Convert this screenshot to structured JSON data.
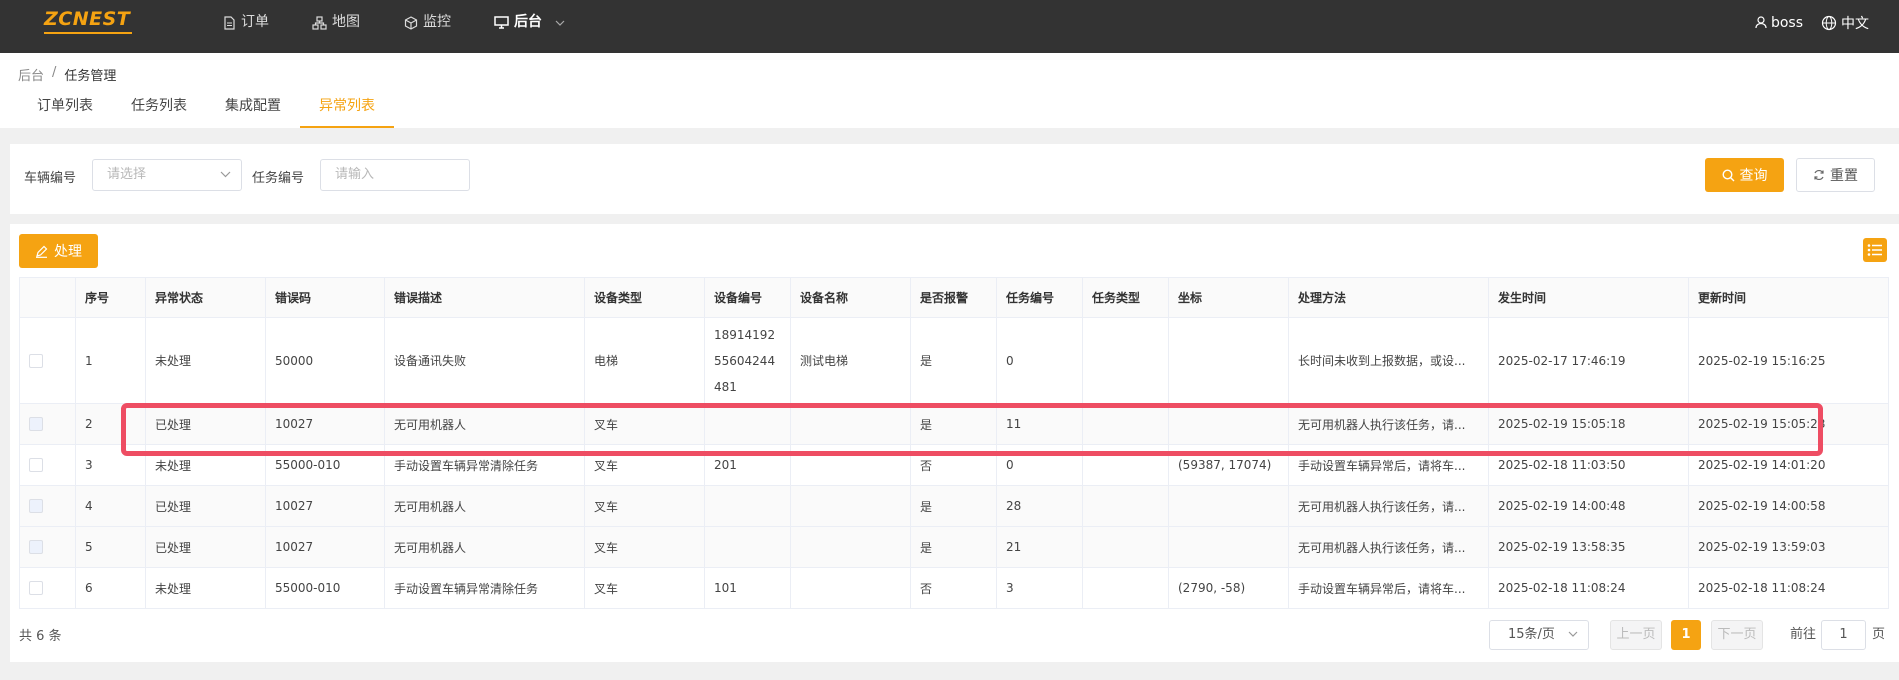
{
  "brand": {
    "logo_text": "ZCNEST",
    "accent": "#f5a312",
    "highlight_color": "#ee4d63"
  },
  "nav": {
    "items": [
      {
        "label": "订单",
        "icon": "document-icon"
      },
      {
        "label": "地图",
        "icon": "sitemap-icon"
      },
      {
        "label": "监控",
        "icon": "cube-icon"
      },
      {
        "label": "后台",
        "icon": "monitor-icon"
      }
    ],
    "user": "boss",
    "language": "中文"
  },
  "breadcrumb": {
    "root": "后台",
    "sep": "/",
    "current": "任务管理"
  },
  "tabs": [
    "订单列表",
    "任务列表",
    "集成配置",
    "异常列表"
  ],
  "active_tab": "异常列表",
  "filter": {
    "vehicle_label": "车辆编号",
    "vehicle_placeholder": "请选择",
    "task_label": "任务编号",
    "task_placeholder": "请输入",
    "query_label": "查询",
    "reset_label": "重置"
  },
  "toolbar": {
    "handle_label": "处理"
  },
  "table": {
    "headers": [
      "",
      "序号",
      "异常状态",
      "错误码",
      "错误描述",
      "设备类型",
      "设备编号",
      "设备名称",
      "是否报警",
      "任务编号",
      "任务类型",
      "坐标",
      "处理方法",
      "发生时间",
      "更新时间"
    ],
    "rows": [
      {
        "no": "1",
        "status": "未处理",
        "code": "50000",
        "desc": "设备通讯失败",
        "dtype": "电梯",
        "dno": "1891419255604244481",
        "dname": "测试电梯",
        "alarm": "是",
        "task": "0",
        "ttype": "",
        "coord": "",
        "method": "长时间未收到上报数据，或设...",
        "occur": "2025-02-17 17:46:19",
        "update": "2025-02-19 15:16:25"
      },
      {
        "no": "2",
        "status": "已处理",
        "code": "10027",
        "desc": "无可用机器人",
        "dtype": "叉车",
        "dno": "",
        "dname": "",
        "alarm": "是",
        "task": "11",
        "ttype": "",
        "coord": "",
        "method": "无可用机器人执行该任务，请...",
        "occur": "2025-02-19 15:05:18",
        "update": "2025-02-19 15:05:23"
      },
      {
        "no": "3",
        "status": "未处理",
        "code": "55000-010",
        "desc": "手动设置车辆异常清除任务",
        "dtype": "叉车",
        "dno": "201",
        "dname": "",
        "alarm": "否",
        "task": "0",
        "ttype": "",
        "coord": "(59387, 17074)",
        "method": "手动设置车辆异常后，请将车...",
        "occur": "2025-02-18 11:03:50",
        "update": "2025-02-19 14:01:20"
      },
      {
        "no": "4",
        "status": "已处理",
        "code": "10027",
        "desc": "无可用机器人",
        "dtype": "叉车",
        "dno": "",
        "dname": "",
        "alarm": "是",
        "task": "28",
        "ttype": "",
        "coord": "",
        "method": "无可用机器人执行该任务，请...",
        "occur": "2025-02-19 14:00:48",
        "update": "2025-02-19 14:00:58"
      },
      {
        "no": "5",
        "status": "已处理",
        "code": "10027",
        "desc": "无可用机器人",
        "dtype": "叉车",
        "dno": "",
        "dname": "",
        "alarm": "是",
        "task": "21",
        "ttype": "",
        "coord": "",
        "method": "无可用机器人执行该任务，请...",
        "occur": "2025-02-19 13:58:35",
        "update": "2025-02-19 13:59:03"
      },
      {
        "no": "6",
        "status": "未处理",
        "code": "55000-010",
        "desc": "手动设置车辆异常清除任务",
        "dtype": "叉车",
        "dno": "101",
        "dname": "",
        "alarm": "否",
        "task": "3",
        "ttype": "",
        "coord": "(2790, -58)",
        "method": "手动设置车辆异常后，请将车...",
        "occur": "2025-02-18 11:08:24",
        "update": "2025-02-18 11:08:24"
      }
    ]
  },
  "footer": {
    "total": "共 6 条",
    "page_size": "15条/页",
    "prev": "上一页",
    "current_page": "1",
    "next": "下一页",
    "goto_label": "前往",
    "goto_value": "1",
    "goto_suffix": "页"
  }
}
